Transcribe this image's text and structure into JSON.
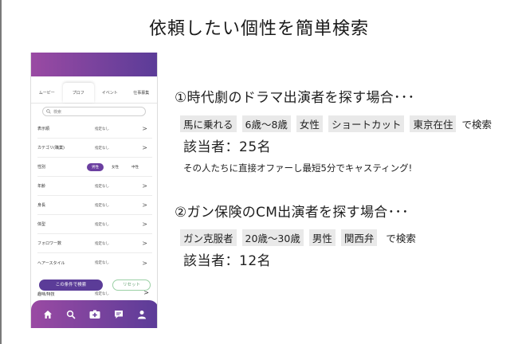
{
  "slide": {
    "title": "依頼したい個性を簡単検索"
  },
  "phone": {
    "tabs": [
      {
        "label": "ムービー",
        "active": false
      },
      {
        "label": "プロフ",
        "active": true
      },
      {
        "label": "イベント",
        "active": false
      },
      {
        "label": "仕事募集",
        "active": false
      }
    ],
    "search_placeholder": "検索",
    "filters": [
      {
        "label": "表示順",
        "value": "指定なし"
      },
      {
        "label": "カテゴリ(職業)",
        "value": "指定なし"
      },
      {
        "label": "性別",
        "options": [
          "男性",
          "女性",
          "中性"
        ],
        "selected": "男性"
      },
      {
        "label": "年齢",
        "value": "指定なし"
      },
      {
        "label": "身長",
        "value": "指定なし"
      },
      {
        "label": "体型",
        "value": "指定なし"
      },
      {
        "label": "フォロワー数",
        "value": "指定なし"
      },
      {
        "label": "ヘアースタイル",
        "value": "指定なし"
      }
    ],
    "partial_filter": {
      "label": "趣味/特技",
      "value": "指定なし"
    },
    "search_button": "この条件で検索",
    "reset_button": "リセット",
    "chevron": ">",
    "nav_icons": [
      "home-icon",
      "search-icon",
      "medical-plus-icon",
      "chat-icon",
      "user-icon"
    ],
    "colors": {
      "gradient_start": "#9a4aa3",
      "gradient_end": "#5b3c98",
      "reset_border": "#9bd0a5"
    }
  },
  "case1": {
    "title": "①時代劇のドラマ出演者を探す場合･･･",
    "tags": [
      "馬に乗れる",
      "6歳～8歳",
      "女性",
      "ショートカット",
      "東京在住"
    ],
    "suffix": "で検索",
    "count": "該当者：25名",
    "note": "その人たちに直接オファーし最短5分でキャスティング!"
  },
  "case2": {
    "title": "②ガン保険のCM出演者を探す場合･･･",
    "tags": [
      "ガン克服者",
      "20歳～30歳",
      "男性",
      "関西弁"
    ],
    "suffix": "で検索",
    "count": "該当者：12名"
  }
}
